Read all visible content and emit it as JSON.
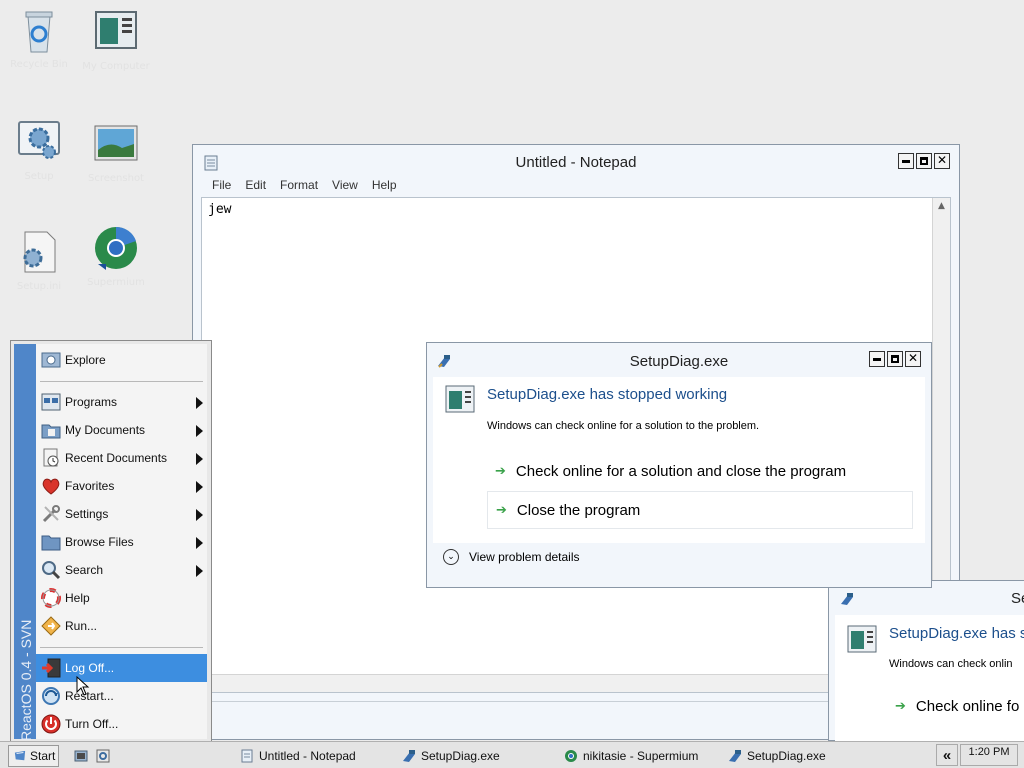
{
  "desktop": {
    "icons": [
      {
        "name": "recycle-bin-icon",
        "label": "Recycle Bin"
      },
      {
        "name": "my-computer-icon",
        "label": "My Computer"
      },
      {
        "name": "setup-icon",
        "label": "Setup"
      },
      {
        "name": "screenshot-icon",
        "label": "Screenshot"
      },
      {
        "name": "setup-file-icon",
        "label": "Setup.ini"
      },
      {
        "name": "supermium-icon",
        "label": "Supermium"
      }
    ]
  },
  "notepad": {
    "title": "Untitled - Notepad",
    "menu": [
      "File",
      "Edit",
      "Format",
      "View",
      "Help"
    ],
    "content": "jew"
  },
  "dialog": {
    "title": "SetupDiag.exe",
    "heading": "SetupDiag.exe has stopped working",
    "message": "Windows can check online for a solution to the problem.",
    "option1": "Check online for a solution and close the program",
    "option2": "Close the program",
    "details": "View problem details"
  },
  "dialog2": {
    "title": "Se",
    "heading": "SetupDiag.exe has s",
    "message": "Windows can check onlin",
    "option1": "Check online fo"
  },
  "start_menu": {
    "side_label": "ReactOS 0.4 - SVN",
    "items": {
      "explore": "Explore",
      "programs": "Programs",
      "documents": "My Documents",
      "recent": "Recent Documents",
      "favorites": "Favorites",
      "settings": "Settings",
      "browse": "Browse Files",
      "search": "Search",
      "help": "Help",
      "run": "Run...",
      "logoff": "Log Off...",
      "restart": "Restart...",
      "turnoff": "Turn Off..."
    }
  },
  "taskbar": {
    "start": "Start",
    "tasks": [
      "Untitled - Notepad",
      "SetupDiag.exe",
      "nikitasie - Supermium",
      "SetupDiag.exe"
    ],
    "tray_toggle": "«",
    "clock": "1:20 PM"
  }
}
